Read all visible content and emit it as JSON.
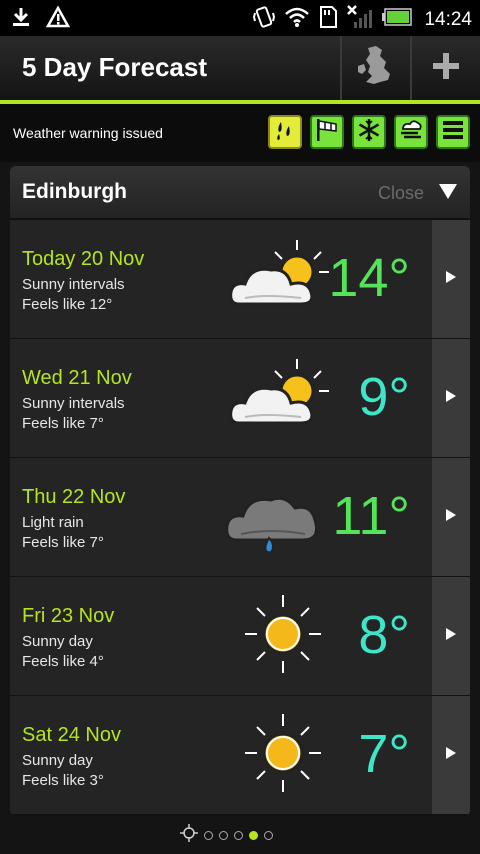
{
  "status_bar": {
    "time": "14:24",
    "icons": [
      "download-icon",
      "alert-triangle-icon",
      "vibrate-icon",
      "wifi-icon",
      "sd-card-icon",
      "no-signal-icon",
      "battery-icon"
    ]
  },
  "header": {
    "title": "5 Day Forecast",
    "buttons": [
      "uk-map-icon",
      "plus-icon"
    ]
  },
  "warning": {
    "text": "Weather warning issued",
    "icons": [
      "rain-warning-icon",
      "wind-warning-icon",
      "snow-warning-icon",
      "fog-warning-icon",
      "menu-icon"
    ]
  },
  "location": {
    "name": "Edinburgh",
    "close_label": "Close"
  },
  "colors": {
    "accent": "#b5e61d",
    "temp_green": "#55e35a",
    "temp_cyan": "#3de6c8"
  },
  "days": [
    {
      "date": "Today 20 Nov",
      "condition": "Sunny intervals",
      "feels": "Feels like 12°",
      "temp": "14°",
      "icon": "sunny-intervals-icon"
    },
    {
      "date": "Wed 21 Nov",
      "condition": "Sunny intervals",
      "feels": "Feels like 7°",
      "temp": "9°",
      "icon": "sunny-intervals-icon"
    },
    {
      "date": "Thu 22 Nov",
      "condition": "Light rain",
      "feels": "Feels like 7°",
      "temp": "11°",
      "icon": "light-rain-icon"
    },
    {
      "date": "Fri 23 Nov",
      "condition": "Sunny day",
      "feels": "Feels like 4°",
      "temp": "8°",
      "icon": "sun-icon"
    },
    {
      "date": "Sat 24 Nov",
      "condition": "Sunny day",
      "feels": "Feels like 3°",
      "temp": "7°",
      "icon": "sun-icon"
    }
  ],
  "pager": {
    "page_count": 5,
    "active_page": 4
  }
}
